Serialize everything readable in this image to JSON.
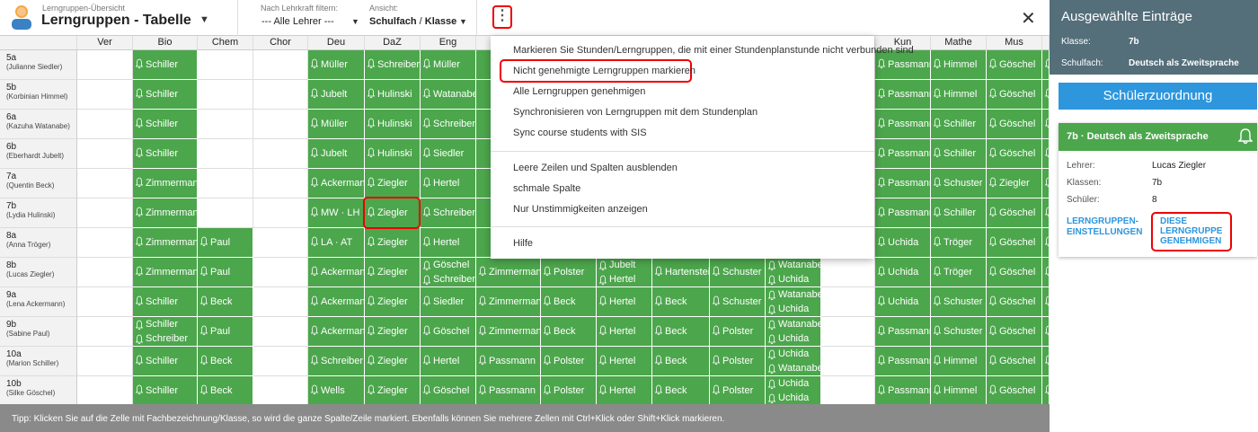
{
  "header": {
    "subtitle": "Lerngruppen-Übersicht",
    "title": "Lerngruppen - Tabelle",
    "filter_label": "Nach Lehrkraft filtern:",
    "filter_value": "--- Alle Lehrer ---",
    "view_label": "Ansicht:",
    "view_value_a": "Schulfach",
    "view_value_sep": " / ",
    "view_value_b": "Klasse"
  },
  "columns": [
    "Ver",
    "Bio",
    "Chem",
    "Chor",
    "Deu",
    "DaZ",
    "Eng",
    "Kun",
    "Mathe",
    "Mus"
  ],
  "rows": [
    {
      "name": "5a",
      "teacher": "(Julianne Siedler)"
    },
    {
      "name": "5b",
      "teacher": "(Korbinian Himmel)"
    },
    {
      "name": "6a",
      "teacher": "(Kazuha Watanabe)"
    },
    {
      "name": "6b",
      "teacher": "(Eberhardt Jubelt)"
    },
    {
      "name": "7a",
      "teacher": "(Quentin Beck)"
    },
    {
      "name": "7b",
      "teacher": "(Lydia Hulinski)"
    },
    {
      "name": "8a",
      "teacher": "(Anna Tröger)"
    },
    {
      "name": "8b",
      "teacher": "(Lucas Ziegler)"
    },
    {
      "name": "9a",
      "teacher": "(Lena Ackermann)"
    },
    {
      "name": "9b",
      "teacher": "(Sabine Paul)"
    },
    {
      "name": "10a",
      "teacher": "(Marion Schiller)"
    },
    {
      "name": "10b",
      "teacher": "(Silke Göschel)"
    }
  ],
  "cells": {
    "bio": [
      "Schiller",
      "Schiller",
      "Schiller",
      "Schiller",
      "Zimmermann",
      "Zimmermann",
      "Zimmermann",
      "Zimmermann",
      "Schiller",
      "Schiller|Schreiber",
      "Schiller",
      "Schiller"
    ],
    "chem": [
      "",
      "",
      "",
      "",
      "",
      "",
      "Paul",
      "Paul",
      "Beck",
      "Paul",
      "Beck",
      "Beck"
    ],
    "deu": [
      "Müller",
      "Jubelt",
      "Müller",
      "Jubelt",
      "Ackermann",
      "MW · LH",
      "LA · AT",
      "Ackermann",
      "Ackermann",
      "Ackermann",
      "Schreiber",
      "Wells"
    ],
    "daz": [
      "Schreiber",
      "Hulinski",
      "Hulinski",
      "Hulinski",
      "Ziegler",
      "Ziegler",
      "Ziegler",
      "Ziegler",
      "Ziegler",
      "Ziegler",
      "Ziegler",
      "Ziegler"
    ],
    "eng": [
      "Müller",
      "Watanabe",
      "Schreiber",
      "Siedler",
      "Hertel",
      "Schreiber",
      "Hertel",
      "Göschel|Schreiber",
      "Siedler",
      "Göschel",
      "Hertel",
      "Göschel"
    ],
    "kun": [
      "Passmann",
      "Passmann",
      "Passmann",
      "Passmann",
      "Passmann",
      "Passmann",
      "Uchida",
      "Uchida",
      "Uchida",
      "Passmann",
      "Passmann",
      "Passmann"
    ],
    "mathe": [
      "Himmel",
      "Himmel",
      "Schiller",
      "Schiller",
      "Schuster",
      "Schiller",
      "Tröger",
      "Tröger",
      "Schuster",
      "Schuster",
      "Himmel",
      "Himmel"
    ],
    "mus": [
      "Göschel",
      "Göschel",
      "Göschel",
      "Göschel",
      "Ziegler",
      "Göschel",
      "Göschel",
      "Göschel",
      "Göschel",
      "Göschel",
      "Göschel",
      "Göschel"
    ],
    "hidden_rows": [
      [
        "Zimmermann",
        "Polster",
        "Jubelt|Hertel",
        "Hartenstein",
        "Schuster",
        "Watanabe|Uchida"
      ],
      [
        "Zimmermann",
        "Beck",
        "Hertel",
        "Beck",
        "Schuster",
        "Watanabe|Uchida"
      ],
      [
        "Zimmermann",
        "Beck",
        "Hertel",
        "Beck",
        "Polster",
        "Watanabe|Uchida"
      ],
      [
        "Passmann",
        "Polster",
        "Hertel",
        "Beck",
        "Polster",
        "Uchida|Watanabe"
      ],
      [
        "Passmann",
        "Polster",
        "Hertel",
        "Beck",
        "Polster",
        "Uchida|Uchida"
      ]
    ]
  },
  "menu": {
    "items": [
      "Markieren Sie Stunden/Lerngruppen, die mit einer Stundenplanstunde nicht verbunden sind",
      "Nicht genehmigte Lerngruppen markieren",
      "Alle Lerngruppen genehmigen",
      "Synchronisieren von Lerngruppen mit dem Stundenplan",
      "Sync course students with SIS",
      "Leere Zeilen und Spalten ausblenden",
      "schmale Spalte",
      "Nur Unstimmigkeiten anzeigen",
      "Hilfe"
    ]
  },
  "tip": "Tipp: Klicken Sie auf die Zelle mit Fachbezeichnung/Klasse, so wird die ganze Spalte/Zeile markiert. Ebenfalls können Sie mehrere Zellen mit Ctrl+Klick oder Shift+Klick markieren.",
  "panel": {
    "title": "Ausgewählte Einträge",
    "klasse_label": "Klasse:",
    "klasse_value": "7b",
    "fach_label": "Schulfach:",
    "fach_value": "Deutsch als Zweitsprache",
    "button": "Schülerzuordnung",
    "card_title": "7b · Deutsch als Zweitsprache",
    "lehrer_label": "Lehrer:",
    "lehrer_value": "Lucas Ziegler",
    "klassen_label": "Klassen:",
    "klassen_value": "7b",
    "schueler_label": "Schüler:",
    "schueler_value": "8",
    "link_settings_1": "LERNGRUPPEN-",
    "link_settings_2": "EINSTELLUNGEN",
    "link_approve_1": "DIESE",
    "link_approve_2": "LERNGRUPPE",
    "link_approve_3": "GENEHMIGEN"
  },
  "colors": {
    "green": "#4ca64c",
    "panel_header": "#546e7a",
    "button_blue": "#2d96dc",
    "highlight_red": "#e00"
  },
  "icons": [
    "avatar-icon",
    "kebab-menu-icon",
    "close-icon",
    "bell-icon",
    "chevron-down-icon"
  ]
}
